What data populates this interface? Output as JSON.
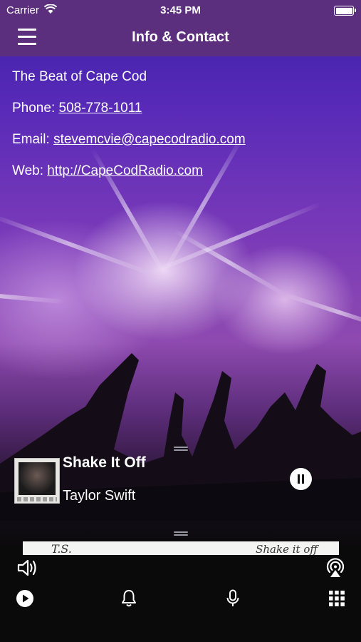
{
  "status": {
    "carrier": "Carrier",
    "time": "3:45 PM"
  },
  "nav": {
    "title": "Info & Contact",
    "menu_icon": "hamburger-menu-icon"
  },
  "info": {
    "station": "The Beat of Cape Cod",
    "phone_label": "Phone:",
    "phone": "508-778-1011",
    "email_label": "Email:",
    "email": "stevemcvie@capecodradio.com",
    "web_label": "Web:",
    "web": "http://CapeCodRadio.com"
  },
  "now_playing": {
    "title": "Shake It Off",
    "artist": "Taylor Swift",
    "state": "playing",
    "signature_left": "T.S.",
    "signature_right": "Shake it off"
  },
  "controls": {
    "volume_icon": "speaker-volume-icon",
    "airplay_icon": "airplay-icon",
    "tabs": [
      {
        "icon": "play-icon"
      },
      {
        "icon": "bell-icon"
      },
      {
        "icon": "microphone-icon"
      },
      {
        "icon": "grid-icon"
      }
    ]
  }
}
